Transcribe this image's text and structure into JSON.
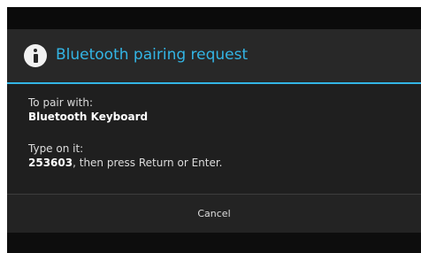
{
  "dialog": {
    "title": "Bluetooth pairing request",
    "icon": "info-icon",
    "accent_color": "#33b5e5",
    "pair_label": "To pair with:",
    "device_name": "Bluetooth Keyboard",
    "type_label": "Type on it:",
    "passkey": "253603",
    "instruction": ", then press Return or Enter.",
    "cancel_label": "Cancel"
  }
}
